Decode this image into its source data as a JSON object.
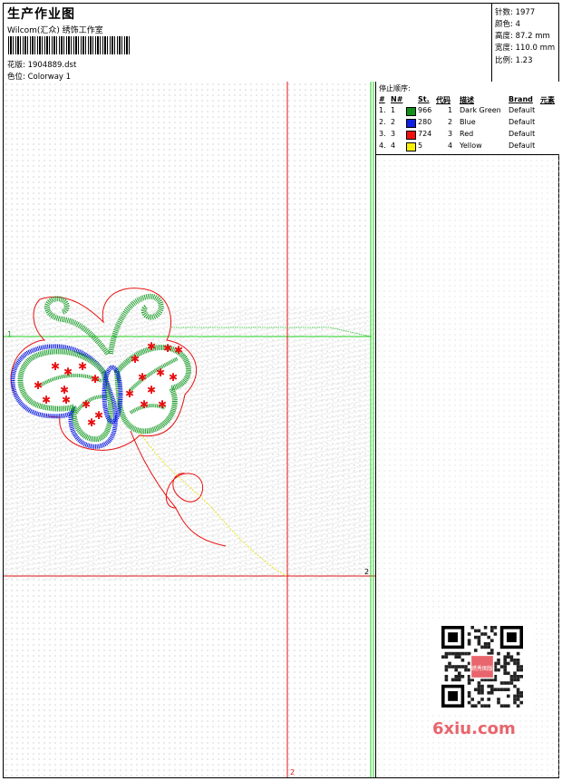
{
  "header": {
    "title": "生产作业图",
    "company": "Wilcom(汇众) 绣饰工作室",
    "pattern_label": "花版:",
    "pattern_value": "1904889.dst",
    "colorway_label": "色位:",
    "colorway_value": "Colorway 1"
  },
  "stats": {
    "stitches": "针数: 1977",
    "colors": "颜色: 4",
    "height": "高度: 87.2 mm",
    "width": "宽度: 110.0 mm",
    "scale": "比例: 1.23"
  },
  "sequence": {
    "title": "停止顺序:",
    "columns": {
      "idx": "#",
      "no": "N#",
      "st": "St.",
      "code": "代码",
      "desc": "描述",
      "brand": "Brand",
      "elem": "元素"
    },
    "rows": [
      {
        "idx": "1.",
        "no": "1",
        "color": "#109018",
        "st": "966",
        "code": "1",
        "desc": "Dark Green",
        "brand": "Default"
      },
      {
        "idx": "2.",
        "no": "2",
        "color": "#1020e0",
        "st": "280",
        "code": "2",
        "desc": "Blue",
        "brand": "Default"
      },
      {
        "idx": "3.",
        "no": "3",
        "color": "#f01010",
        "st": "724",
        "code": "3",
        "desc": "Red",
        "brand": "Default"
      },
      {
        "idx": "4.",
        "no": "4",
        "color": "#f8f000",
        "st": "5",
        "code": "4",
        "desc": "Yellow",
        "brand": "Default"
      }
    ]
  },
  "markers": {
    "one": "1",
    "two_right": "2",
    "two_bottom": "2"
  },
  "watermark": {
    "text": "6xiu.com",
    "seal": "绣秀图版"
  }
}
